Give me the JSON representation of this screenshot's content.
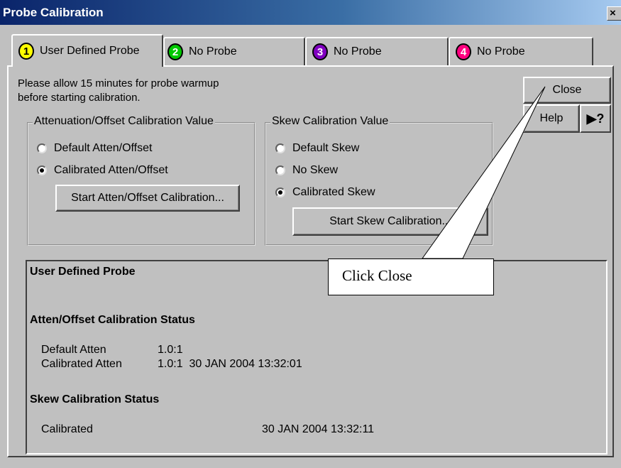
{
  "window": {
    "title": "Probe Calibration",
    "close_glyph": "×"
  },
  "tabs": [
    {
      "number": "1",
      "label": "User Defined Probe",
      "color": "#ffff00",
      "text_color": "#000000"
    },
    {
      "number": "2",
      "label": "No Probe",
      "color": "#00c800",
      "text_color": "#ffffff"
    },
    {
      "number": "3",
      "label": "No Probe",
      "color": "#8000c0",
      "text_color": "#ffffff"
    },
    {
      "number": "4",
      "label": "No Probe",
      "color": "#ff0080",
      "text_color": "#ffffff"
    }
  ],
  "instructions": {
    "line1": "Please allow 15 minutes for probe warmup",
    "line2": "before starting calibration."
  },
  "buttons": {
    "close": "Close",
    "help": "Help",
    "help_pointer": "?",
    "start_atten": "Start Atten/Offset Calibration...",
    "start_skew": "Start Skew Calibration..."
  },
  "atten_group": {
    "title": "Attenuation/Offset Calibration Value",
    "options": [
      {
        "label": "Default Atten/Offset",
        "selected": false
      },
      {
        "label": "Calibrated Atten/Offset",
        "selected": true
      }
    ]
  },
  "skew_group": {
    "title": "Skew Calibration Value",
    "options": [
      {
        "label": "Default Skew",
        "selected": false
      },
      {
        "label": "No Skew",
        "selected": false
      },
      {
        "label": "Calibrated Skew",
        "selected": true
      }
    ]
  },
  "status": {
    "probe_name": "User Defined Probe",
    "atten_heading": "Atten/Offset Calibration Status",
    "default_atten_label": "Default Atten",
    "default_atten_value": "1.0:1",
    "calibrated_atten_label": "Calibrated Atten",
    "calibrated_atten_value": "1.0:1  30 JAN 2004 13:32:01",
    "skew_heading": "Skew Calibration Status",
    "calibrated_label": "Calibrated",
    "calibrated_value": "30 JAN 2004 13:32:11"
  },
  "callout": {
    "text": "Click Close"
  }
}
